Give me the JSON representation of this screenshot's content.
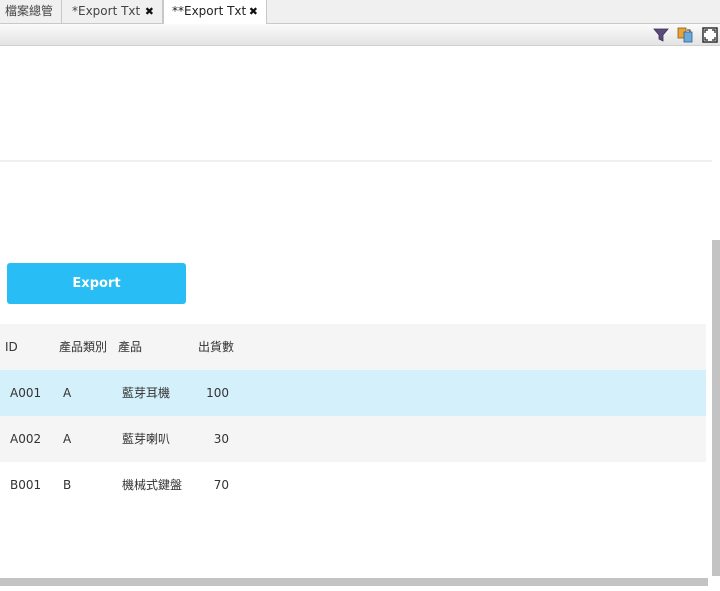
{
  "tabs": [
    {
      "label": "檔案總管",
      "closable": false,
      "active": false
    },
    {
      "label": "*Export Txt",
      "closable": true,
      "active": false
    },
    {
      "label": "**Export Txt",
      "closable": true,
      "active": true
    }
  ],
  "toolbar": {
    "icons": [
      "filter-icon",
      "swap-icon",
      "fullscreen-icon"
    ]
  },
  "export_button": {
    "label": "Export"
  },
  "colors": {
    "accent": "#29bdf5",
    "row_highlight": "#d4f0fb"
  },
  "grid": {
    "columns": [
      "ID",
      "產品類別",
      "產品",
      "出貨數"
    ],
    "rows": [
      {
        "id": "A001",
        "category": "A",
        "product": "藍芽耳機",
        "qty": "100"
      },
      {
        "id": "A002",
        "category": "A",
        "product": "藍芽喇叭",
        "qty": "30"
      },
      {
        "id": "B001",
        "category": "B",
        "product": "機械式鍵盤",
        "qty": "70"
      }
    ]
  }
}
